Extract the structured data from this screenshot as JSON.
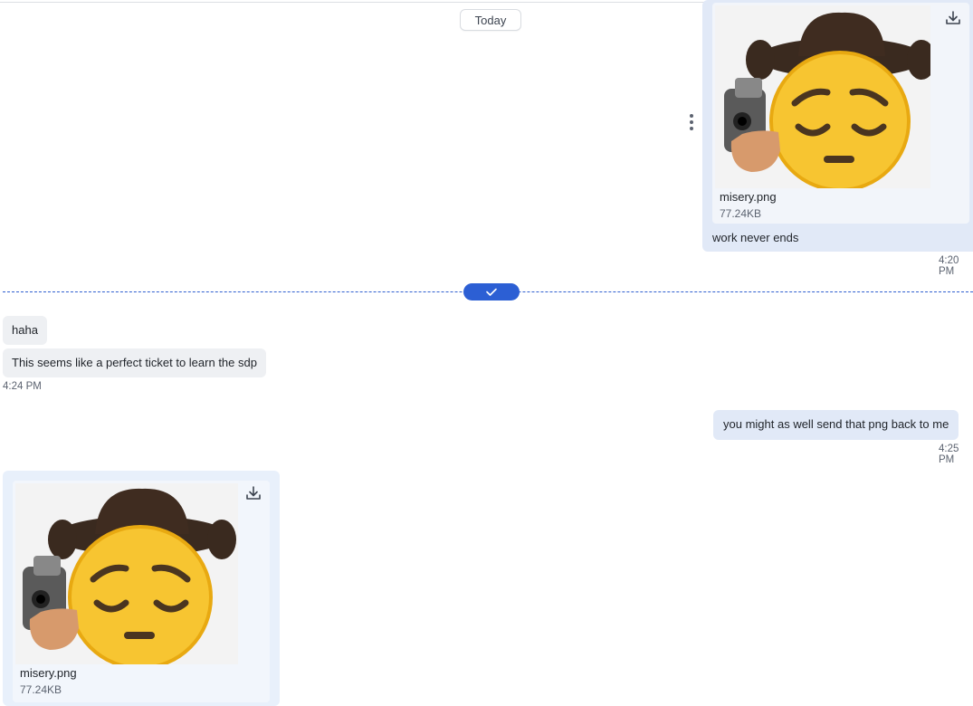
{
  "date_separator": "Today",
  "messages": {
    "out_attachment": {
      "file_name": "misery.png",
      "file_size": "77.24KB",
      "caption": "work never ends",
      "time": "4:20 PM"
    },
    "in_text_1": "haha",
    "in_text_2": "This seems like a perfect ticket to learn the sdp",
    "in_time": "4:24 PM",
    "out_text": "you might as well send that png back to me",
    "out_text_time": "4:25 PM",
    "in_attachment": {
      "file_name": "misery.png",
      "file_size": "77.24KB"
    }
  },
  "icons": {
    "download": "download-icon",
    "more": "more-vertical-icon",
    "read": "check-icon"
  },
  "colors": {
    "accent": "#2c5fd4",
    "outgoing_bubble": "#e1e9f7",
    "incoming_bubble": "#eef0f3"
  }
}
